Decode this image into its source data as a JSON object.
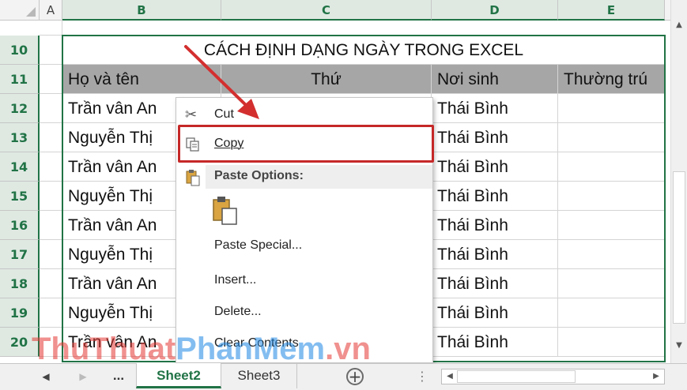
{
  "columns": [
    "A",
    "B",
    "C",
    "D",
    "E"
  ],
  "rows": [
    "10",
    "11",
    "12",
    "13",
    "14",
    "15",
    "16",
    "17",
    "18",
    "19",
    "20"
  ],
  "title": "CÁCH ĐỊNH DẠNG NGÀY TRONG EXCEL",
  "headers": {
    "b": "Họ và tên",
    "c": "Thứ",
    "d": "Nơi sinh",
    "e": "Thường trú"
  },
  "data_rows": [
    {
      "b": "Trần vân An",
      "d": "Thái Bình"
    },
    {
      "b": "Nguyễn Thị",
      "d": "Thái Bình"
    },
    {
      "b": "Trần vân An",
      "d": "Thái Bình"
    },
    {
      "b": "Nguyễn Thị",
      "d": "Thái Bình"
    },
    {
      "b": "Trần vân An",
      "d": "Thái Bình"
    },
    {
      "b": "Nguyễn Thị",
      "d": "Thái Bình"
    },
    {
      "b": "Trần vân An",
      "d": "Thái Bình"
    },
    {
      "b": "Nguyễn Thị",
      "d": "Thái Bình"
    },
    {
      "b": "Trần vân An",
      "d": "Thái Bình"
    }
  ],
  "context_menu": {
    "cut": "Cut",
    "copy": "Copy",
    "paste_options": "Paste Options:",
    "paste_special": "Paste Special...",
    "insert": "Insert...",
    "delete": "Delete...",
    "clear_contents": "Clear Contents"
  },
  "tabs": {
    "ellipsis": "...",
    "sheet2": "Sheet2",
    "sheet3": "Sheet3",
    "add": "+"
  },
  "watermark": {
    "part1": "ThuThuat",
    "part2": "PhanMem",
    "part3": ".vn"
  },
  "colors": {
    "accent": "#217346",
    "highlight": "#c62828",
    "header_fill": "#a6a6a6"
  }
}
